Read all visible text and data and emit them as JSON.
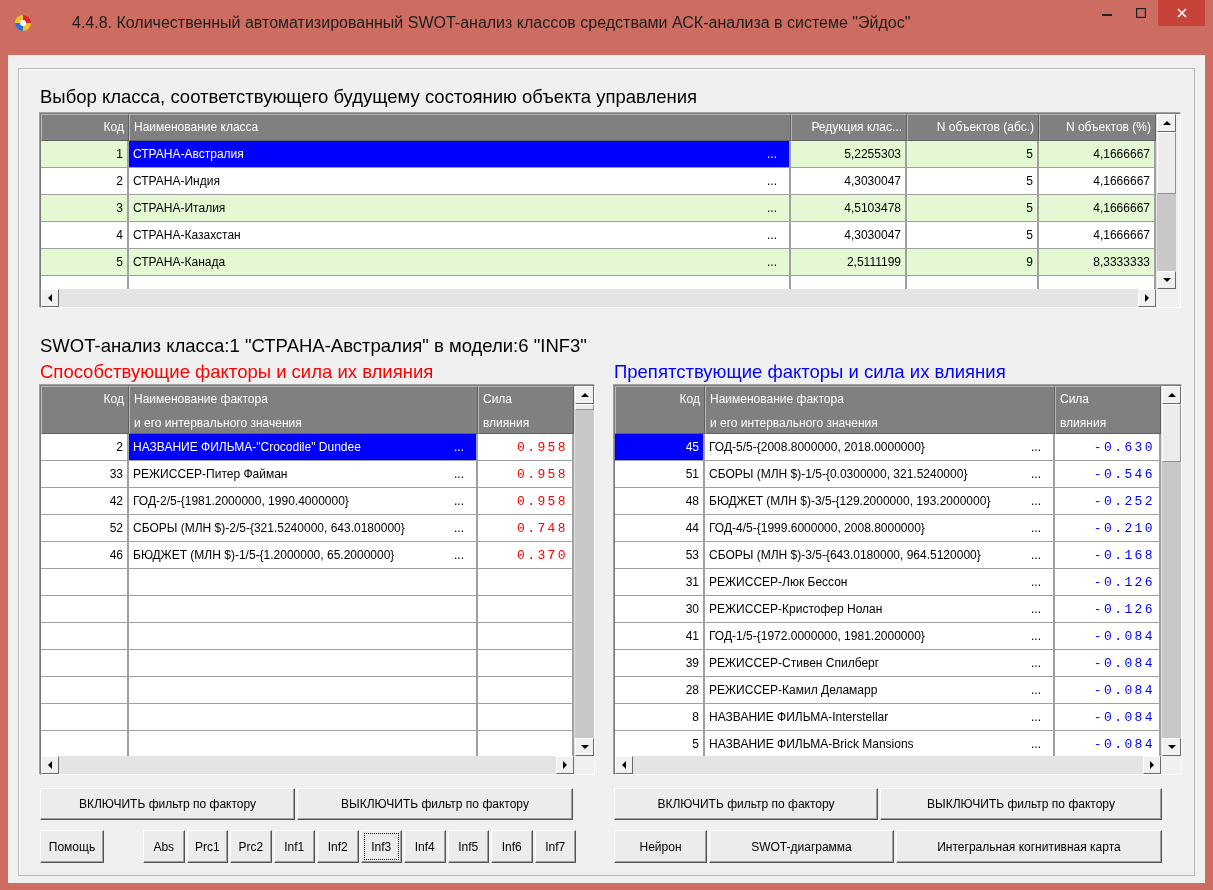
{
  "window": {
    "title": "4.4.8. Количественный автоматизированный SWOT-анализ классов средствами АСК-анализа в системе \"Эйдос\""
  },
  "class_selection": {
    "title": "Выбор класса, соответствующего будущему состоянию объекта управления",
    "columns": [
      "Код",
      "Наименование класса",
      "Редукция клас...",
      "N объектов (абс.)",
      "N объектов (%)"
    ],
    "rows": [
      {
        "code": "1",
        "name": "СТРАНА-Австралия",
        "more": "...",
        "reduction": "5,2255303",
        "n_abs": "5",
        "n_pct": "4,1666667",
        "selected": true
      },
      {
        "code": "2",
        "name": "СТРАНА-Индия",
        "more": "...",
        "reduction": "4,3030047",
        "n_abs": "5",
        "n_pct": "4,1666667",
        "selected": false
      },
      {
        "code": "3",
        "name": "СТРАНА-Италия",
        "more": "...",
        "reduction": "4,5103478",
        "n_abs": "5",
        "n_pct": "4,1666667",
        "selected": false
      },
      {
        "code": "4",
        "name": "СТРАНА-Казахстан",
        "more": "...",
        "reduction": "4,3030047",
        "n_abs": "5",
        "n_pct": "4,1666667",
        "selected": false
      },
      {
        "code": "5",
        "name": "СТРАНА-Канада",
        "more": "...",
        "reduction": "2,5111199",
        "n_abs": "9",
        "n_pct": "8,3333333",
        "selected": false
      }
    ]
  },
  "swot": {
    "title": "SWOT-анализ класса:1 \"СТРАНА-Австралия\" в модели:6 \"INF3\"",
    "panels": [
      {
        "kind": "promoting",
        "title": "Способствующие факторы и сила их влияния",
        "columns": [
          "Код",
          "Наименование фактора\nи его интервального значения",
          "Сила\nвлияния"
        ],
        "rows": [
          {
            "code": "2",
            "name": "НАЗВАНИЕ ФИЛЬМА-\"Crocodile\" Dundee",
            "more": "...",
            "strength": "0.958",
            "selected": true
          },
          {
            "code": "33",
            "name": "РЕЖИССЕР-Питер Файман",
            "more": "...",
            "strength": "0.958",
            "selected": false
          },
          {
            "code": "42",
            "name": "ГОД-2/5-{1981.2000000, 1990.4000000}",
            "more": "...",
            "strength": "0.958",
            "selected": false
          },
          {
            "code": "52",
            "name": "СБОРЫ (МЛН $)-2/5-{321.5240000, 643.0180000}",
            "more": "...",
            "strength": "0.748",
            "selected": false
          },
          {
            "code": "46",
            "name": "БЮДЖЕТ (МЛН $)-1/5-{1.2000000, 65.2000000}",
            "more": "...",
            "strength": "0.370",
            "selected": false
          }
        ],
        "filter_buttons": [
          "ВКЛЮЧИТЬ фильтр по фактору",
          "ВЫКЛЮЧИТЬ фильтр по фактору"
        ],
        "help_button": "Помощь",
        "model_buttons": [
          {
            "label": "Abs",
            "selected": false
          },
          {
            "label": "Prc1",
            "selected": false
          },
          {
            "label": "Prc2",
            "selected": false
          },
          {
            "label": "Inf1",
            "selected": false
          },
          {
            "label": "Inf2",
            "selected": false
          },
          {
            "label": "Inf3",
            "selected": true
          },
          {
            "label": "Inf4",
            "selected": false
          },
          {
            "label": "Inf5",
            "selected": false
          },
          {
            "label": "Inf6",
            "selected": false
          },
          {
            "label": "Inf7",
            "selected": false
          }
        ]
      },
      {
        "kind": "obstructing",
        "title": "Препятствующие факторы и сила их влияния",
        "columns": [
          "Код",
          "Наименование фактора\nи его интервального значения",
          "Сила\nвлияния"
        ],
        "rows": [
          {
            "code": "45",
            "name": "ГОД-5/5-{2008.8000000, 2018.0000000}",
            "more": "...",
            "strength": "-0.630",
            "selected": true
          },
          {
            "code": "51",
            "name": "СБОРЫ (МЛН $)-1/5-{0.0300000, 321.5240000}",
            "more": "...",
            "strength": "-0.546",
            "selected": false
          },
          {
            "code": "48",
            "name": "БЮДЖЕТ (МЛН $)-3/5-{129.2000000, 193.2000000}",
            "more": "...",
            "strength": "-0.252",
            "selected": false
          },
          {
            "code": "44",
            "name": "ГОД-4/5-{1999.6000000, 2008.8000000}",
            "more": "...",
            "strength": "-0.210",
            "selected": false
          },
          {
            "code": "53",
            "name": "СБОРЫ (МЛН $)-3/5-{643.0180000, 964.5120000}",
            "more": "...",
            "strength": "-0.168",
            "selected": false
          },
          {
            "code": "31",
            "name": "РЕЖИССЕР-Люк Бессон",
            "more": "...",
            "strength": "-0.126",
            "selected": false
          },
          {
            "code": "30",
            "name": "РЕЖИССЕР-Кристофер Нолан",
            "more": "...",
            "strength": "-0.126",
            "selected": false
          },
          {
            "code": "41",
            "name": "ГОД-1/5-{1972.0000000, 1981.2000000}",
            "more": "...",
            "strength": "-0.084",
            "selected": false
          },
          {
            "code": "39",
            "name": "РЕЖИССЕР-Стивен Спилберг",
            "more": "...",
            "strength": "-0.084",
            "selected": false
          },
          {
            "code": "28",
            "name": "РЕЖИССЕР-Камил Деламарр",
            "more": "...",
            "strength": "-0.084",
            "selected": false
          },
          {
            "code": "8",
            "name": "НАЗВАНИЕ ФИЛЬМА-Interstellar",
            "more": "...",
            "strength": "-0.084",
            "selected": false
          },
          {
            "code": "5",
            "name": "НАЗВАНИЕ ФИЛЬМА-Brick Mansions",
            "more": "...",
            "strength": "-0.084",
            "selected": false
          }
        ],
        "filter_buttons": [
          "ВКЛЮЧИТЬ фильтр по фактору",
          "ВЫКЛЮЧИТЬ фильтр по фактору"
        ],
        "action_buttons": [
          "Нейрон",
          "SWOT-диаграмма",
          "Интегральная когнитивная карта"
        ]
      }
    ]
  }
}
